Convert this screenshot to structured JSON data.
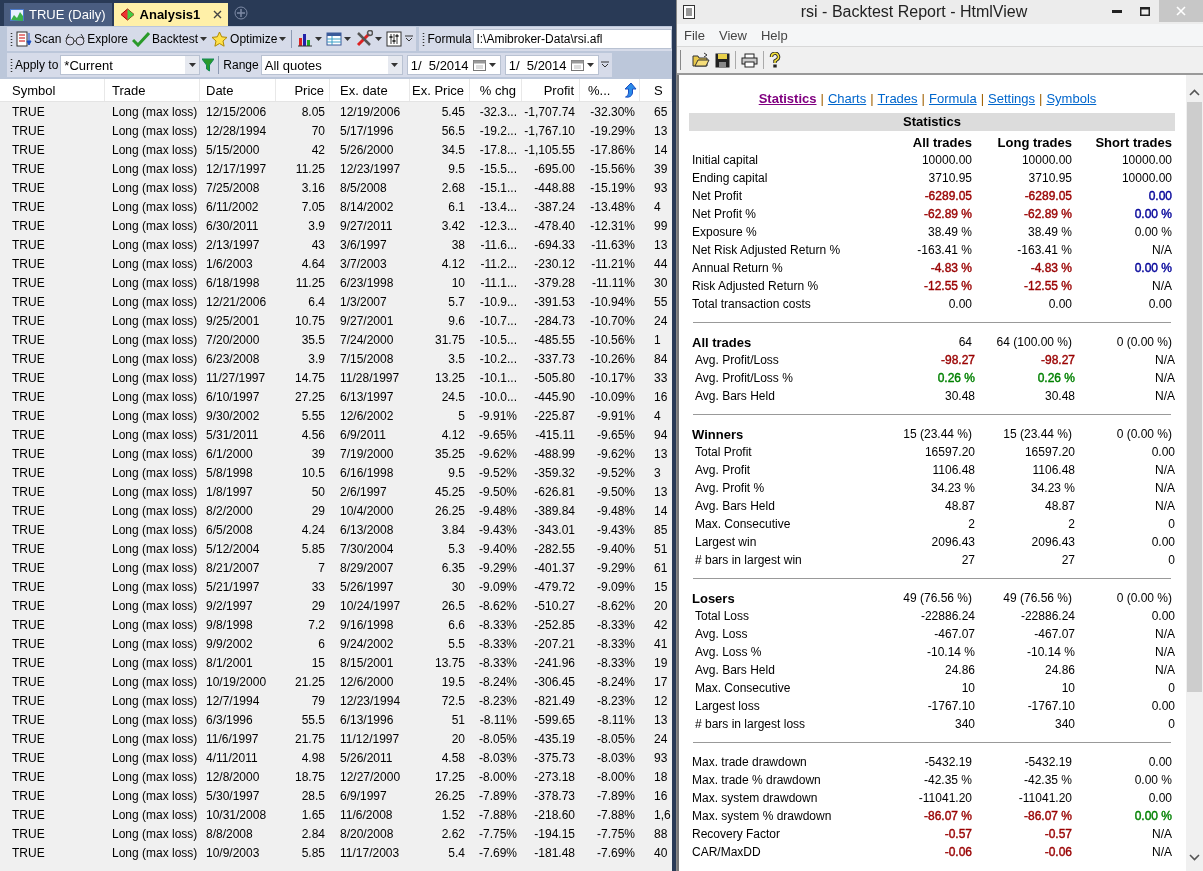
{
  "analysis": {
    "tabs": [
      {
        "label": "TRUE (Daily)",
        "selected": false,
        "kind": "chart"
      },
      {
        "label": "Analysis1",
        "selected": true,
        "kind": "analysis"
      }
    ],
    "toolbar": {
      "buttons": [
        {
          "label": "Scan",
          "kind": "scan",
          "dropdown": false
        },
        {
          "label": "Explore",
          "kind": "explore",
          "dropdown": false
        },
        {
          "label": "Backtest",
          "kind": "backtest",
          "dropdown": true
        },
        {
          "label": "Optimize",
          "kind": "optimize",
          "dropdown": true
        },
        {
          "kind": "chart",
          "dropdown": true
        },
        {
          "kind": "report",
          "dropdown": true
        },
        {
          "kind": "tools",
          "dropdown": true
        },
        {
          "kind": "sliders",
          "dropdown": false
        }
      ],
      "formula_label": "Formula",
      "formula": "I:\\Amibroker-Data\\rsi.afl"
    },
    "filter": {
      "apply_label": "Apply to",
      "apply_value": "*Current",
      "range_label": "Range",
      "range_value": "All quotes",
      "from": "1/  5/2014",
      "to": "1/  5/2014"
    },
    "table": {
      "columns": [
        {
          "label": "Symbol",
          "sorted": false
        },
        {
          "label": "Trade",
          "sorted": false
        },
        {
          "label": "Date",
          "sorted": false
        },
        {
          "label": "Price",
          "sorted": false
        },
        {
          "label": "Ex. date",
          "sorted": false
        },
        {
          "label": "Ex. Price",
          "sorted": false
        },
        {
          "label": "% chg",
          "sorted": false
        },
        {
          "label": "Profit",
          "sorted": false
        },
        {
          "label": "%...",
          "sorted": true
        },
        {
          "label": "S",
          "sorted": false
        }
      ],
      "rows": [
        [
          "TRUE",
          "Long (max loss)",
          "12/15/2006",
          "8.05",
          "12/19/2006",
          "5.45",
          "-32.3...",
          "-1,707.74",
          "-32.30%",
          "65"
        ],
        [
          "TRUE",
          "Long (max loss)",
          "12/28/1994",
          "70",
          "5/17/1996",
          "56.5",
          "-19.2...",
          "-1,767.10",
          "-19.29%",
          "13"
        ],
        [
          "TRUE",
          "Long (max loss)",
          "5/15/2000",
          "42",
          "5/26/2000",
          "34.5",
          "-17.8...",
          "-1,105.55",
          "-17.86%",
          "14"
        ],
        [
          "TRUE",
          "Long (max loss)",
          "12/17/1997",
          "11.25",
          "12/23/1997",
          "9.5",
          "-15.5...",
          "-695.00",
          "-15.56%",
          "39"
        ],
        [
          "TRUE",
          "Long (max loss)",
          "7/25/2008",
          "3.16",
          "8/5/2008",
          "2.68",
          "-15.1...",
          "-448.88",
          "-15.19%",
          "93"
        ],
        [
          "TRUE",
          "Long (max loss)",
          "6/11/2002",
          "7.05",
          "8/14/2002",
          "6.1",
          "-13.4...",
          "-387.24",
          "-13.48%",
          "4"
        ],
        [
          "TRUE",
          "Long (max loss)",
          "6/30/2011",
          "3.9",
          "9/27/2011",
          "3.42",
          "-12.3...",
          "-478.40",
          "-12.31%",
          "99"
        ],
        [
          "TRUE",
          "Long (max loss)",
          "2/13/1997",
          "43",
          "3/6/1997",
          "38",
          "-11.6...",
          "-694.33",
          "-11.63%",
          "13"
        ],
        [
          "TRUE",
          "Long (max loss)",
          "1/6/2003",
          "4.64",
          "3/7/2003",
          "4.12",
          "-11.2...",
          "-230.12",
          "-11.21%",
          "44"
        ],
        [
          "TRUE",
          "Long (max loss)",
          "6/18/1998",
          "11.25",
          "6/23/1998",
          "10",
          "-11.1...",
          "-379.28",
          "-11.11%",
          "30"
        ],
        [
          "TRUE",
          "Long (max loss)",
          "12/21/2006",
          "6.4",
          "1/3/2007",
          "5.7",
          "-10.9...",
          "-391.53",
          "-10.94%",
          "55"
        ],
        [
          "TRUE",
          "Long (max loss)",
          "9/25/2001",
          "10.75",
          "9/27/2001",
          "9.6",
          "-10.7...",
          "-284.73",
          "-10.70%",
          "24"
        ],
        [
          "TRUE",
          "Long (max loss)",
          "7/20/2000",
          "35.5",
          "7/24/2000",
          "31.75",
          "-10.5...",
          "-485.55",
          "-10.56%",
          "1"
        ],
        [
          "TRUE",
          "Long (max loss)",
          "6/23/2008",
          "3.9",
          "7/15/2008",
          "3.5",
          "-10.2...",
          "-337.73",
          "-10.26%",
          "84"
        ],
        [
          "TRUE",
          "Long (max loss)",
          "11/27/1997",
          "14.75",
          "11/28/1997",
          "13.25",
          "-10.1...",
          "-505.80",
          "-10.17%",
          "33"
        ],
        [
          "TRUE",
          "Long (max loss)",
          "6/10/1997",
          "27.25",
          "6/13/1997",
          "24.5",
          "-10.0...",
          "-445.90",
          "-10.09%",
          "16"
        ],
        [
          "TRUE",
          "Long (max loss)",
          "9/30/2002",
          "5.55",
          "12/6/2002",
          "5",
          "-9.91%",
          "-225.87",
          "-9.91%",
          "4"
        ],
        [
          "TRUE",
          "Long (max loss)",
          "5/31/2011",
          "4.56",
          "6/9/2011",
          "4.12",
          "-9.65%",
          "-415.11",
          "-9.65%",
          "94"
        ],
        [
          "TRUE",
          "Long (max loss)",
          "6/1/2000",
          "39",
          "7/19/2000",
          "35.25",
          "-9.62%",
          "-488.99",
          "-9.62%",
          "13"
        ],
        [
          "TRUE",
          "Long (max loss)",
          "5/8/1998",
          "10.5",
          "6/16/1998",
          "9.5",
          "-9.52%",
          "-359.32",
          "-9.52%",
          "3"
        ],
        [
          "TRUE",
          "Long (max loss)",
          "1/8/1997",
          "50",
          "2/6/1997",
          "45.25",
          "-9.50%",
          "-626.81",
          "-9.50%",
          "13"
        ],
        [
          "TRUE",
          "Long (max loss)",
          "8/2/2000",
          "29",
          "10/4/2000",
          "26.25",
          "-9.48%",
          "-389.84",
          "-9.48%",
          "14"
        ],
        [
          "TRUE",
          "Long (max loss)",
          "6/5/2008",
          "4.24",
          "6/13/2008",
          "3.84",
          "-9.43%",
          "-343.01",
          "-9.43%",
          "85"
        ],
        [
          "TRUE",
          "Long (max loss)",
          "5/12/2004",
          "5.85",
          "7/30/2004",
          "5.3",
          "-9.40%",
          "-282.55",
          "-9.40%",
          "51"
        ],
        [
          "TRUE",
          "Long (max loss)",
          "8/21/2007",
          "7",
          "8/29/2007",
          "6.35",
          "-9.29%",
          "-401.37",
          "-9.29%",
          "61"
        ],
        [
          "TRUE",
          "Long (max loss)",
          "5/21/1997",
          "33",
          "5/26/1997",
          "30",
          "-9.09%",
          "-479.72",
          "-9.09%",
          "15"
        ],
        [
          "TRUE",
          "Long (max loss)",
          "9/2/1997",
          "29",
          "10/24/1997",
          "26.5",
          "-8.62%",
          "-510.27",
          "-8.62%",
          "20"
        ],
        [
          "TRUE",
          "Long (max loss)",
          "9/8/1998",
          "7.2",
          "9/16/1998",
          "6.6",
          "-8.33%",
          "-252.85",
          "-8.33%",
          "42"
        ],
        [
          "TRUE",
          "Long (max loss)",
          "9/9/2002",
          "6",
          "9/24/2002",
          "5.5",
          "-8.33%",
          "-207.21",
          "-8.33%",
          "41"
        ],
        [
          "TRUE",
          "Long (max loss)",
          "8/1/2001",
          "15",
          "8/15/2001",
          "13.75",
          "-8.33%",
          "-241.96",
          "-8.33%",
          "19"
        ],
        [
          "TRUE",
          "Long (max loss)",
          "10/19/2000",
          "21.25",
          "12/6/2000",
          "19.5",
          "-8.24%",
          "-306.45",
          "-8.24%",
          "17"
        ],
        [
          "TRUE",
          "Long (max loss)",
          "12/7/1994",
          "79",
          "12/23/1994",
          "72.5",
          "-8.23%",
          "-821.49",
          "-8.23%",
          "12"
        ],
        [
          "TRUE",
          "Long (max loss)",
          "6/3/1996",
          "55.5",
          "6/13/1996",
          "51",
          "-8.11%",
          "-599.65",
          "-8.11%",
          "13"
        ],
        [
          "TRUE",
          "Long (max loss)",
          "11/6/1997",
          "21.75",
          "11/12/1997",
          "20",
          "-8.05%",
          "-435.19",
          "-8.05%",
          "24"
        ],
        [
          "TRUE",
          "Long (max loss)",
          "4/11/2011",
          "4.98",
          "5/26/2011",
          "4.58",
          "-8.03%",
          "-375.73",
          "-8.03%",
          "93"
        ],
        [
          "TRUE",
          "Long (max loss)",
          "12/8/2000",
          "18.75",
          "12/27/2000",
          "17.25",
          "-8.00%",
          "-273.18",
          "-8.00%",
          "18"
        ],
        [
          "TRUE",
          "Long (max loss)",
          "5/30/1997",
          "28.5",
          "6/9/1997",
          "26.25",
          "-7.89%",
          "-378.73",
          "-7.89%",
          "16"
        ],
        [
          "TRUE",
          "Long (max loss)",
          "10/31/2008",
          "1.65",
          "11/6/2008",
          "1.52",
          "-7.88%",
          "-218.60",
          "-7.88%",
          "1,6"
        ],
        [
          "TRUE",
          "Long (max loss)",
          "8/8/2008",
          "2.84",
          "8/20/2008",
          "2.62",
          "-7.75%",
          "-194.15",
          "-7.75%",
          "88"
        ],
        [
          "TRUE",
          "Long (max loss)",
          "10/9/2003",
          "5.85",
          "11/17/2003",
          "5.4",
          "-7.69%",
          "-181.48",
          "-7.69%",
          "40"
        ]
      ]
    }
  },
  "report": {
    "title": "rsi - Backtest Report - HtmlView",
    "menu": [
      "File",
      "View",
      "Help"
    ],
    "nav_separator": "|",
    "nav": [
      {
        "label": "Statistics",
        "selected": true
      },
      {
        "label": "Charts",
        "selected": false
      },
      {
        "label": "Trades",
        "selected": false
      },
      {
        "label": "Formula",
        "selected": false
      },
      {
        "label": "Settings",
        "selected": false
      },
      {
        "label": "Symbols",
        "selected": false
      }
    ],
    "stats": {
      "title": "Statistics",
      "columns": [
        "All trades",
        "Long trades",
        "Short trades"
      ],
      "sections": [
        {
          "rows": [
            {
              "label": "Initial capital",
              "kind": "plain",
              "values": [
                "10000.00",
                "10000.00",
                "10000.00"
              ]
            },
            {
              "label": "Ending capital",
              "kind": "plain",
              "values": [
                "3710.95",
                "3710.95",
                "10000.00"
              ]
            },
            {
              "label": "Net Profit",
              "kind": "plain",
              "values": [
                {
                  "text": "-6289.05",
                  "color": "#990000"
                },
                {
                  "text": "-6289.05",
                  "color": "#990000"
                },
                {
                  "text": "0.00",
                  "color": "#000099"
                }
              ]
            },
            {
              "label": "Net Profit %",
              "kind": "plain",
              "values": [
                {
                  "text": "-62.89 %",
                  "color": "#990000"
                },
                {
                  "text": "-62.89 %",
                  "color": "#990000"
                },
                {
                  "text": "0.00 %",
                  "color": "#000099"
                }
              ]
            },
            {
              "label": "Exposure %",
              "kind": "plain",
              "values": [
                "38.49 %",
                "38.49 %",
                "0.00 %"
              ]
            },
            {
              "label": "Net Risk Adjusted Return %",
              "kind": "plain",
              "values": [
                "-163.41 %",
                "-163.41 %",
                "N/A"
              ]
            },
            {
              "label": "Annual Return %",
              "kind": "plain",
              "values": [
                {
                  "text": "-4.83 %",
                  "color": "#990000"
                },
                {
                  "text": "-4.83 %",
                  "color": "#990000"
                },
                {
                  "text": "0.00 %",
                  "color": "#000099"
                }
              ]
            },
            {
              "label": "Risk Adjusted Return %",
              "kind": "plain",
              "values": [
                {
                  "text": "-12.55 %",
                  "color": "#990000"
                },
                {
                  "text": "-12.55 %",
                  "color": "#990000"
                },
                "N/A"
              ]
            },
            {
              "label": "Total transaction costs",
              "kind": "plain",
              "values": [
                "0.00",
                "0.00",
                "0.00"
              ]
            }
          ]
        },
        {
          "rows": [
            {
              "label": "All trades",
              "kind": "head",
              "values": [
                "64",
                "64 (100.00 %)",
                "0 (0.00 %)"
              ]
            },
            {
              "label": "Avg. Profit/Loss",
              "kind": "sub",
              "values": [
                {
                  "text": "-98.27",
                  "color": "#990000"
                },
                {
                  "text": "-98.27",
                  "color": "#990000"
                },
                "N/A"
              ]
            },
            {
              "label": "Avg. Profit/Loss %",
              "kind": "sub",
              "values": [
                {
                  "text": "0.26 %",
                  "color": "#008000"
                },
                {
                  "text": "0.26 %",
                  "color": "#008000"
                },
                "N/A"
              ]
            },
            {
              "label": "Avg. Bars Held",
              "kind": "sub",
              "values": [
                "30.48",
                "30.48",
                "N/A"
              ]
            }
          ]
        },
        {
          "rows": [
            {
              "label": "Winners",
              "kind": "head",
              "values": [
                "15 (23.44 %)",
                "15 (23.44 %)",
                "0 (0.00 %)"
              ]
            },
            {
              "label": "Total Profit",
              "kind": "sub",
              "values": [
                "16597.20",
                "16597.20",
                "0.00"
              ]
            },
            {
              "label": "Avg. Profit",
              "kind": "sub",
              "values": [
                "1106.48",
                "1106.48",
                "N/A"
              ]
            },
            {
              "label": "Avg. Profit %",
              "kind": "sub",
              "values": [
                "34.23 %",
                "34.23 %",
                "N/A"
              ]
            },
            {
              "label": "Avg. Bars Held",
              "kind": "sub",
              "values": [
                "48.87",
                "48.87",
                "N/A"
              ]
            },
            {
              "label": "Max. Consecutive",
              "kind": "sub",
              "values": [
                "2",
                "2",
                "0"
              ]
            },
            {
              "label": "Largest win",
              "kind": "sub",
              "values": [
                "2096.43",
                "2096.43",
                "0.00"
              ]
            },
            {
              "label": "# bars in largest win",
              "kind": "sub",
              "values": [
                "27",
                "27",
                "0"
              ]
            }
          ]
        },
        {
          "rows": [
            {
              "label": "Losers",
              "kind": "head",
              "values": [
                "49 (76.56 %)",
                "49 (76.56 %)",
                "0 (0.00 %)"
              ]
            },
            {
              "label": "Total Loss",
              "kind": "sub",
              "values": [
                "-22886.24",
                "-22886.24",
                "0.00"
              ]
            },
            {
              "label": "Avg. Loss",
              "kind": "sub",
              "values": [
                "-467.07",
                "-467.07",
                "N/A"
              ]
            },
            {
              "label": "Avg. Loss %",
              "kind": "sub",
              "values": [
                "-10.14 %",
                "-10.14 %",
                "N/A"
              ]
            },
            {
              "label": "Avg. Bars Held",
              "kind": "sub",
              "values": [
                "24.86",
                "24.86",
                "N/A"
              ]
            },
            {
              "label": "Max. Consecutive",
              "kind": "sub",
              "values": [
                "10",
                "10",
                "0"
              ]
            },
            {
              "label": "Largest loss",
              "kind": "sub",
              "values": [
                "-1767.10",
                "-1767.10",
                "0.00"
              ]
            },
            {
              "label": "# bars in largest loss",
              "kind": "sub",
              "values": [
                "340",
                "340",
                "0"
              ]
            }
          ]
        },
        {
          "rows": [
            {
              "label": "Max. trade drawdown",
              "kind": "plain",
              "values": [
                "-5432.19",
                "-5432.19",
                "0.00"
              ]
            },
            {
              "label": "Max. trade % drawdown",
              "kind": "plain",
              "values": [
                "-42.35 %",
                "-42.35 %",
                "0.00 %"
              ]
            },
            {
              "label": "Max. system drawdown",
              "kind": "plain",
              "values": [
                "-11041.20",
                "-11041.20",
                "0.00"
              ]
            },
            {
              "label": "Max. system % drawdown",
              "kind": "plain",
              "values": [
                {
                  "text": "-86.07 %",
                  "color": "#990000"
                },
                {
                  "text": "-86.07 %",
                  "color": "#990000"
                },
                {
                  "text": "0.00 %",
                  "color": "#008000"
                }
              ]
            },
            {
              "label": "Recovery Factor",
              "kind": "plain",
              "values": [
                {
                  "text": "-0.57",
                  "color": "#990000"
                },
                {
                  "text": "-0.57",
                  "color": "#990000"
                },
                "N/A"
              ]
            },
            {
              "label": "CAR/MaxDD",
              "kind": "plain",
              "values": [
                {
                  "text": "-0.06",
                  "color": "#990000"
                },
                {
                  "text": "-0.06",
                  "color": "#990000"
                },
                "N/A"
              ]
            }
          ]
        }
      ]
    }
  }
}
